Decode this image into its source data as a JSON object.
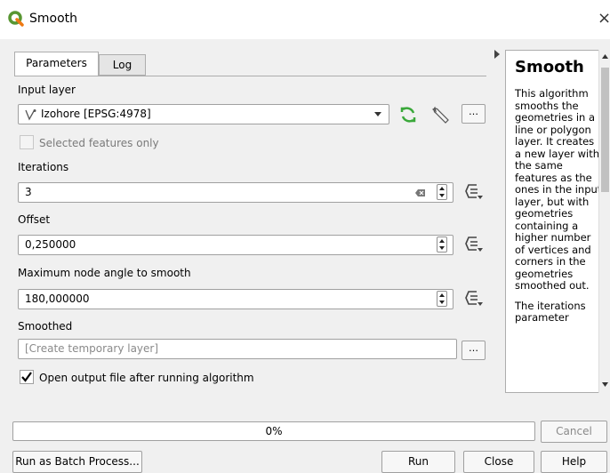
{
  "window": {
    "title": "Smooth",
    "close_symbol": "×"
  },
  "tabs": [
    {
      "label": "Parameters",
      "active": true
    },
    {
      "label": "Log",
      "active": false
    }
  ],
  "params": {
    "input_layer": {
      "label": "Input layer",
      "value": "Izohore [EPSG:4978]",
      "selected_only_label": "Selected features only"
    },
    "iterations": {
      "label": "Iterations",
      "value": "3"
    },
    "offset": {
      "label": "Offset",
      "value": "0,250000"
    },
    "max_angle": {
      "label": "Maximum node angle to smooth",
      "value": "180,000000"
    },
    "smoothed": {
      "label": "Smoothed",
      "placeholder": "[Create temporary layer]"
    },
    "open_output": {
      "label": "Open output file after running algorithm",
      "checked": true
    }
  },
  "help": {
    "title": "Smooth",
    "paragraphs": [
      "This algorithm smooths the geometries in a line or polygon layer. It creates a new layer with the same features as the ones in the input layer, but with geometries containing a higher number of vertices and corners in the geometries smoothed out.",
      "The iterations parameter"
    ]
  },
  "progress": {
    "text": "0%",
    "value": 0
  },
  "buttons": {
    "cancel": "Cancel",
    "batch": "Run as Batch Process...",
    "run": "Run",
    "close": "Close",
    "help": "Help"
  },
  "colors": {
    "qgis_green": "#589632",
    "icon_green": "#3aa83a"
  },
  "icons": {
    "dots": "…"
  }
}
